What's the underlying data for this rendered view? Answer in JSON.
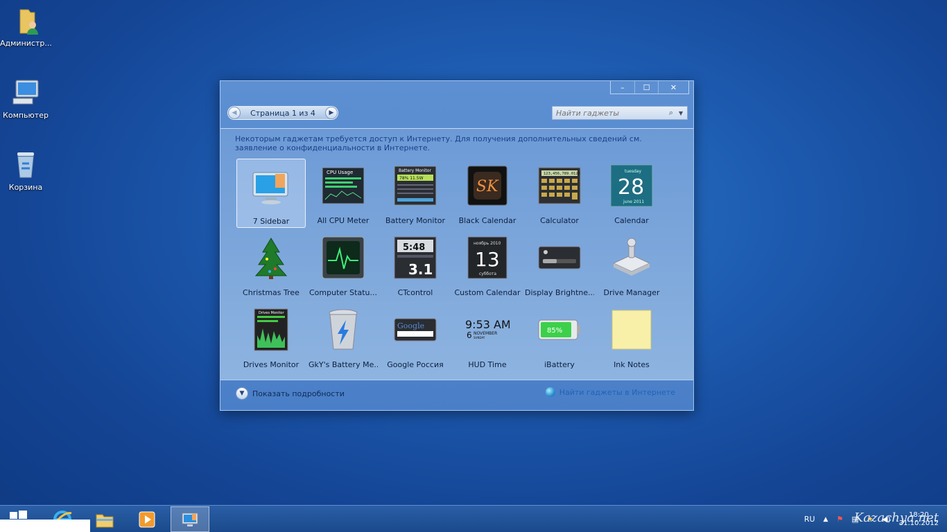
{
  "desktop": {
    "icons": [
      {
        "label": "Администр..."
      },
      {
        "label": "Компьютер"
      },
      {
        "label": "Корзина"
      }
    ]
  },
  "gadget_window": {
    "caption": {
      "minimize": "–",
      "maximize": "☐",
      "close": "✕"
    },
    "pager": {
      "prev": "◀",
      "text": "Страница 1 из 4",
      "next": "▶"
    },
    "search": {
      "placeholder": "Найти гаджеты",
      "button": "⌕",
      "dropdown": "▼"
    },
    "notice": "Некоторым гаджетам требуется доступ к Интернету. Для получения дополнительных сведений см. заявление о конфиденциальности в Интернете.",
    "gadgets": [
      {
        "name": "7 Sidebar",
        "icon": "monitor-icon",
        "selected": true
      },
      {
        "name": "All CPU Meter",
        "icon": "cpu-meter-icon"
      },
      {
        "name": "Battery Monitor",
        "icon": "battery-monitor-icon"
      },
      {
        "name": "Black Calendar",
        "icon": "sk-calendar-icon"
      },
      {
        "name": "Calculator",
        "icon": "calculator-icon"
      },
      {
        "name": "Calendar",
        "icon": "calendar-icon"
      },
      {
        "name": "Christmas Tree",
        "icon": "christmas-tree-icon"
      },
      {
        "name": "Computer Statu...",
        "icon": "heartbeat-monitor-icon"
      },
      {
        "name": "CTcontrol",
        "icon": "ctcontrol-icon"
      },
      {
        "name": "Custom Calendar",
        "icon": "custom-calendar-icon"
      },
      {
        "name": "Display Brightne...",
        "icon": "brightness-icon"
      },
      {
        "name": "Drive Manager",
        "icon": "drive-icon"
      },
      {
        "name": "Drives Monitor",
        "icon": "drives-monitor-icon"
      },
      {
        "name": "GkY's Battery Me...",
        "icon": "recycle-bolt-icon"
      },
      {
        "name": "Google Россия",
        "icon": "google-search-icon"
      },
      {
        "name": "HUD Time",
        "icon": "hud-time-icon"
      },
      {
        "name": "iBattery",
        "icon": "green-battery-icon"
      },
      {
        "name": "Ink Notes",
        "icon": "sticky-note-icon"
      }
    ],
    "thumb_text": {
      "cpu_title": "CPU Usage",
      "battery_title": "Battery Monitor",
      "battery_value": "78%  11.5W",
      "calc_display": "123,456,789.0123",
      "cal_day_name": "tuesday",
      "cal_day": "28",
      "cal_month": "june 2011",
      "ct_time": "5:48",
      "ct_big": "3.1",
      "cc_month": "ноябрь 2010",
      "cc_day": "13",
      "cc_weekday": "суббота",
      "drives_title": "Drives Monitor",
      "google_logo": "Google",
      "hud_time": "9:53 AM",
      "hud_day": "6",
      "hud_month": "NOVEMBER",
      "hud_weekday": "SUNDAY",
      "ibattery_pct": "85%",
      "sk": "SK"
    },
    "footer": {
      "details": "Показать подробности",
      "online": "Найти гаджеты в Интернете"
    }
  },
  "taskbar": {
    "language": "RU",
    "time": "18:20",
    "date": "31.10.2012",
    "watermark": "Kazachya.net"
  }
}
